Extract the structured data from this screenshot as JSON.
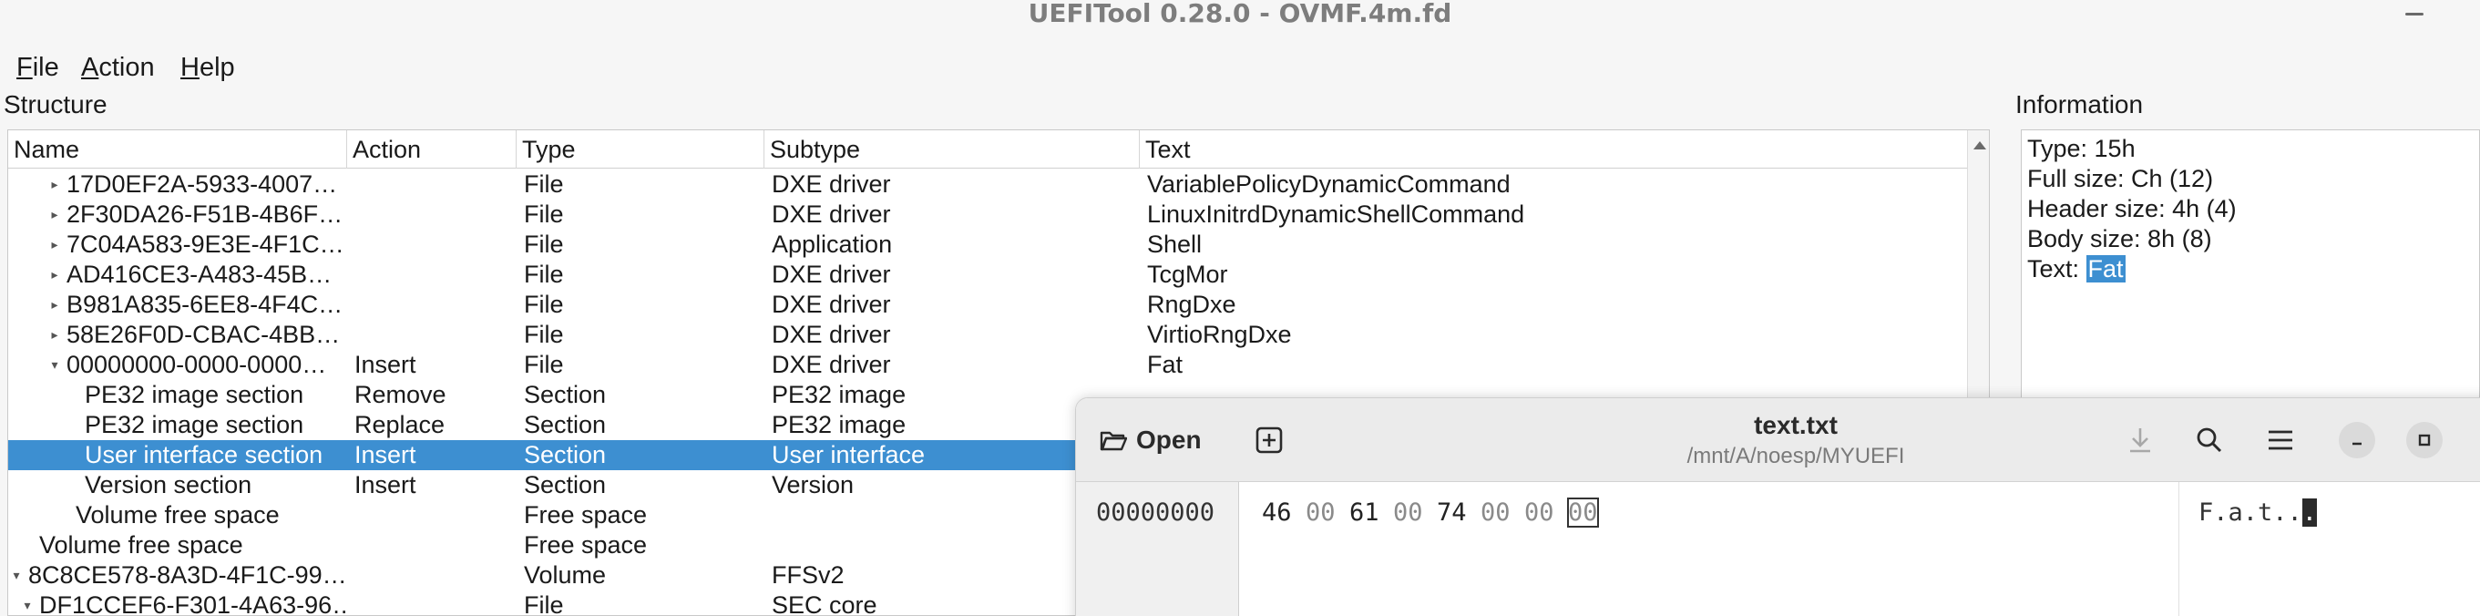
{
  "window": {
    "title": "UEFITool 0.28.0 - OVMF.4m.fd"
  },
  "menu": [
    "File",
    "Action",
    "Help"
  ],
  "structure": {
    "label": "Structure",
    "columns": [
      "Name",
      "Action",
      "Type",
      "Subtype",
      "Text"
    ],
    "rows": [
      {
        "name": "17D0EF2A-5933-4007…",
        "action": "",
        "type": "File",
        "subtype": "DXE driver",
        "text": "VariablePolicyDynamicCommand",
        "expander": "▸"
      },
      {
        "name": "2F30DA26-F51B-4B6F…",
        "action": "",
        "type": "File",
        "subtype": "DXE driver",
        "text": "LinuxInitrdDynamicShellCommand",
        "expander": "▸"
      },
      {
        "name": "7C04A583-9E3E-4F1C…",
        "action": "",
        "type": "File",
        "subtype": "Application",
        "text": "Shell",
        "expander": "▸"
      },
      {
        "name": "AD416CE3-A483-45B…",
        "action": "",
        "type": "File",
        "subtype": "DXE driver",
        "text": "TcgMor",
        "expander": "▸"
      },
      {
        "name": "B981A835-6EE8-4F4C…",
        "action": "",
        "type": "File",
        "subtype": "DXE driver",
        "text": "RngDxe",
        "expander": "▸"
      },
      {
        "name": "58E26F0D-CBAC-4BB…",
        "action": "",
        "type": "File",
        "subtype": "DXE driver",
        "text": "VirtioRngDxe",
        "expander": "▸"
      },
      {
        "name": "00000000-0000-0000…",
        "action": "Insert",
        "type": "File",
        "subtype": "DXE driver",
        "text": "Fat",
        "expander": "▾"
      },
      {
        "name": "PE32 image section",
        "action": "Remove",
        "type": "Section",
        "subtype": "PE32 image",
        "text": "",
        "expander": ""
      },
      {
        "name": "PE32 image section",
        "action": "Replace",
        "type": "Section",
        "subtype": "PE32 image",
        "text": "",
        "expander": ""
      },
      {
        "name": "User interface section",
        "action": "Insert",
        "type": "Section",
        "subtype": "User interface",
        "text": "",
        "expander": "",
        "selected": true
      },
      {
        "name": "Version section",
        "action": "Insert",
        "type": "Section",
        "subtype": "Version",
        "text": "",
        "expander": ""
      },
      {
        "name": "Volume free space",
        "action": "",
        "type": "Free space",
        "subtype": "",
        "text": "",
        "expander": ""
      },
      {
        "name": "Volume free space",
        "action": "",
        "type": "Free space",
        "subtype": "",
        "text": "",
        "expander": ""
      },
      {
        "name": "8C8CE578-8A3D-4F1C-99…",
        "action": "",
        "type": "Volume",
        "subtype": "FFSv2",
        "text": "",
        "expander": "▾"
      },
      {
        "name": "DF1CCEF6-F301-4A63-96…",
        "action": "",
        "type": "File",
        "subtype": "SEC core",
        "text": "",
        "expander": "▾"
      }
    ]
  },
  "information": {
    "label": "Information",
    "lines": [
      "Type: 15h",
      "Full size: Ch (12)",
      "Header size: 4h (4)",
      "Body size: 8h (8)"
    ],
    "text_prefix": "Text: ",
    "text_value": "Fat"
  },
  "hex_editor": {
    "open_label": "Open",
    "title": "text.txt",
    "path": "/mnt/A/noesp/MYUEFI",
    "offset": "00000000",
    "bytes": [
      "46",
      "00",
      "61",
      "00",
      "74",
      "00",
      "00",
      "00"
    ],
    "ascii": "F.a.t..",
    "ascii_cursor": ".",
    "icons": [
      "folder-open-icon",
      "new-tab-icon",
      "download-icon",
      "search-icon",
      "hamburger-menu-icon",
      "minimize-icon",
      "maximize-icon"
    ]
  }
}
